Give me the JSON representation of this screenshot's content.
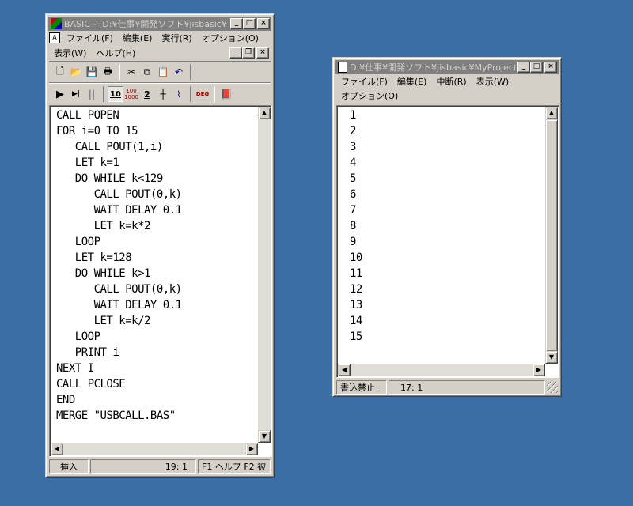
{
  "editor_window": {
    "title": "BASIC - [D:¥仕事¥開発ソフト¥jisbasic¥",
    "menu_row1": [
      "ファイル(F)",
      "編集(E)",
      "実行(R)",
      "オプション(O)"
    ],
    "menu_row2": [
      "表示(W)",
      "ヘルプ(H)"
    ],
    "toolbar1_icons": [
      "new-icon",
      "open-icon",
      "save-icon",
      "print-icon",
      "cut-icon",
      "copy-icon",
      "paste-icon",
      "undo-icon"
    ],
    "toolbar2": {
      "run_glyph": "▶",
      "step_glyph": "▶|",
      "pause_glyph": "||",
      "b10": "10",
      "b1000": "100\n1000",
      "b2": "2",
      "deg": "DEG"
    },
    "code_lines": [
      "CALL POPEN",
      "FOR i=0 TO 15",
      "   CALL POUT(1,i)",
      "   LET k=1",
      "   DO WHILE k<129",
      "      CALL POUT(0,k)",
      "      WAIT DELAY 0.1",
      "      LET k=k*2",
      "   LOOP",
      "   LET k=128",
      "   DO WHILE k>1",
      "      CALL POUT(0,k)",
      "      WAIT DELAY 0.1",
      "      LET k=k/2",
      "   LOOP",
      "   PRINT i",
      "NEXT I",
      "CALL PCLOSE",
      "END",
      "MERGE \"USBCALL.BAS\""
    ],
    "status": {
      "mode": "挿入",
      "position": "19:  1",
      "help": "F1 ヘルプ  F2 被"
    }
  },
  "output_window": {
    "title": "D:¥仕事¥開発ソフト¥jisbasic¥MyProject¥",
    "menu_row1": [
      "ファイル(F)",
      "編集(E)",
      "中断(R)",
      "表示(W)"
    ],
    "menu_row2": [
      "オプション(O)"
    ],
    "lines": [
      "1",
      "2",
      "3",
      "4",
      "5",
      "6",
      "7",
      "8",
      "9",
      "10",
      "11",
      "12",
      "13",
      "14",
      "15"
    ],
    "status": {
      "mode": "書込禁止",
      "position": "17:  1"
    }
  },
  "colors": {
    "desktop": "#3a6ea5",
    "inactive_title": "#808080",
    "face": "#d4d0c8"
  }
}
